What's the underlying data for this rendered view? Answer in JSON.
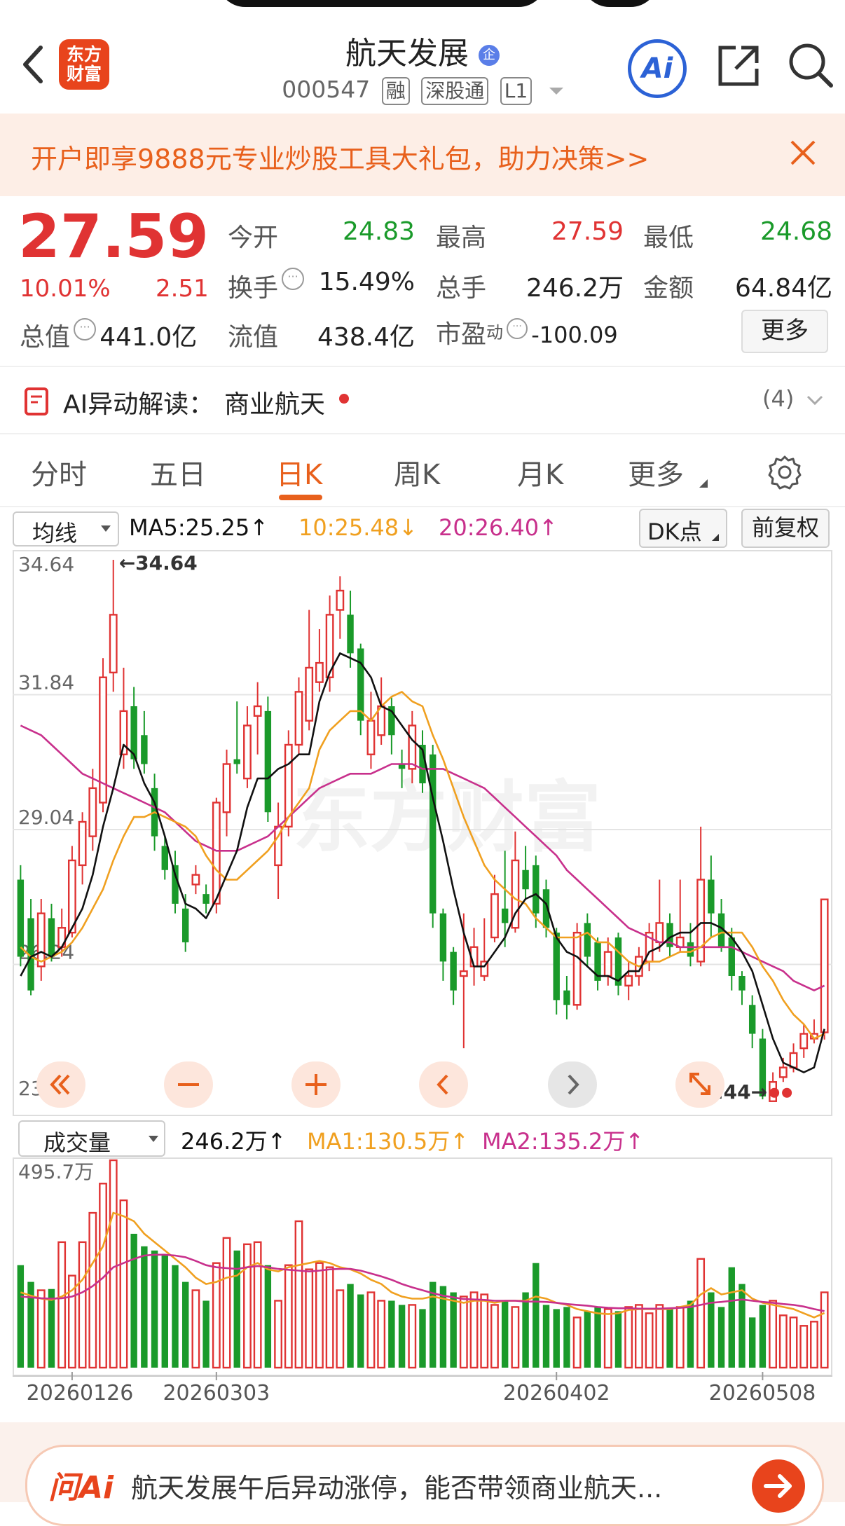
{
  "header": {
    "back_icon": "chevron-left-icon",
    "logo_text": "东方\n财富",
    "logo_line1": "东方",
    "logo_line2": "财富",
    "title": "航天发展",
    "badge": "企",
    "code": "000547",
    "tags": [
      "融",
      "深股通",
      "L1"
    ],
    "ai_label": "Ai",
    "share_icon": "share-icon",
    "search_icon": "search-icon"
  },
  "banner": {
    "text": "开户即享9888元专业炒股工具大礼包，助力决策>>",
    "close_icon": "close-icon"
  },
  "quote": {
    "price": "27.59",
    "change_pct": "10.01%",
    "change": "2.51",
    "open_label": "今开",
    "open": "24.83",
    "high_label": "最高",
    "high": "27.59",
    "low_label": "最低",
    "low": "24.68",
    "turnover_label": "换手",
    "turnover": "15.49%",
    "volume_label": "总手",
    "volume": "246.2万",
    "amount_label": "金额",
    "amount": "64.84亿",
    "mktcap_label": "总值",
    "mktcap": "441.0亿",
    "float_label": "流值",
    "float": "438.4亿",
    "pe_label": "市盈",
    "pe_sup": "动",
    "pe": "-100.09",
    "more": "更多"
  },
  "ai_reading": {
    "label": "AI异动解读：",
    "topic": "商业航天",
    "count": "(4)"
  },
  "tabs": [
    "分时",
    "五日",
    "日K",
    "周K",
    "月K",
    "更多"
  ],
  "active_tab": 2,
  "indicator_bar": {
    "select": "均线",
    "ma5": "MA5:25.25↑",
    "ma10": "10:25.48↓",
    "ma20": "20:26.40↑",
    "dk": "DK点",
    "adjust": "前复权"
  },
  "volume_bar": {
    "select": "成交量",
    "vol": "246.2万↑",
    "ma1": "MA1:130.5万↑",
    "ma2": "MA2:135.2万↑"
  },
  "colors": {
    "up": "#e03333",
    "down": "#1a9a2a",
    "ma5": "#111111",
    "ma10": "#f0a020",
    "ma20": "#c8308c",
    "accent": "#e8601c"
  },
  "chart_data": [
    {
      "type": "candlestick",
      "title": "",
      "y_ticks": [
        "34.64",
        "31.84",
        "29.04",
        "26.24",
        "23.44"
      ],
      "ylim": [
        23.44,
        34.64
      ],
      "max_label": "34.64",
      "min_label": "23.44",
      "x_ticks": [
        "20260126",
        "20260303",
        "20260402",
        "20260508"
      ],
      "candles": [
        [
          28.0,
          26.4,
          28.3,
          26.2
        ],
        [
          27.2,
          25.7,
          27.6,
          25.6
        ],
        [
          26.2,
          27.3,
          27.6,
          25.9
        ],
        [
          27.2,
          26.4,
          27.5,
          26.3
        ],
        [
          26.6,
          27.0,
          27.4,
          26.4
        ],
        [
          26.9,
          28.4,
          28.7,
          26.8
        ],
        [
          28.3,
          29.2,
          29.4,
          27.9
        ],
        [
          28.9,
          29.9,
          30.3,
          28.6
        ],
        [
          29.6,
          32.2,
          32.6,
          29.4
        ],
        [
          32.3,
          33.5,
          34.64,
          31.9
        ],
        [
          30.6,
          31.5,
          32.4,
          30.3
        ],
        [
          31.6,
          30.5,
          32.0,
          30.3
        ],
        [
          31.0,
          30.4,
          31.5,
          30.2
        ],
        [
          29.9,
          28.9,
          30.2,
          28.6
        ],
        [
          28.7,
          28.2,
          28.9,
          28.0
        ],
        [
          28.3,
          27.5,
          28.6,
          27.3
        ],
        [
          27.4,
          26.7,
          27.7,
          26.5
        ],
        [
          27.9,
          28.1,
          28.3,
          27.7
        ],
        [
          27.7,
          27.5,
          27.9,
          27.3
        ],
        [
          27.5,
          29.6,
          29.7,
          27.3
        ],
        [
          29.4,
          30.4,
          30.7,
          28.9
        ],
        [
          30.5,
          30.4,
          31.7,
          30.2
        ],
        [
          30.1,
          31.2,
          31.6,
          29.9
        ],
        [
          31.4,
          31.6,
          32.1,
          30.6
        ],
        [
          31.5,
          29.4,
          31.8,
          29.2
        ],
        [
          28.3,
          29.1,
          29.6,
          27.6
        ],
        [
          29.1,
          30.8,
          31.1,
          28.9
        ],
        [
          30.8,
          31.9,
          32.2,
          30.6
        ],
        [
          31.3,
          32.4,
          33.6,
          31.1
        ],
        [
          32.1,
          32.5,
          33.2,
          31.9
        ],
        [
          32.2,
          33.5,
          33.9,
          31.9
        ],
        [
          33.6,
          34.0,
          34.3,
          33.0
        ],
        [
          33.5,
          32.7,
          34.0,
          32.4
        ],
        [
          32.8,
          31.3,
          32.9,
          31.0
        ],
        [
          30.6,
          31.3,
          31.9,
          30.3
        ],
        [
          31.0,
          31.6,
          32.2,
          30.8
        ],
        [
          31.6,
          31.0,
          31.8,
          30.6
        ],
        [
          30.4,
          30.3,
          30.7,
          29.9
        ],
        [
          30.3,
          31.2,
          31.5,
          30.0
        ],
        [
          30.8,
          30.0,
          31.1,
          29.8
        ],
        [
          30.6,
          27.3,
          30.8,
          27.0
        ],
        [
          27.3,
          26.3,
          27.4,
          25.9
        ],
        [
          26.5,
          25.7,
          26.6,
          25.4
        ],
        [
          26.0,
          26.1,
          27.3,
          24.5
        ],
        [
          26.2,
          26.6,
          27.0,
          25.8
        ],
        [
          26.0,
          26.3,
          27.2,
          25.9
        ],
        [
          26.8,
          27.7,
          28.1,
          26.7
        ],
        [
          27.4,
          27.1,
          28.6,
          26.6
        ],
        [
          27.0,
          28.4,
          29.0,
          26.9
        ],
        [
          28.2,
          27.8,
          28.7,
          27.6
        ],
        [
          28.3,
          27.3,
          28.5,
          27.0
        ],
        [
          27.8,
          27.0,
          28.0,
          26.8
        ],
        [
          26.9,
          25.5,
          27.0,
          25.2
        ],
        [
          25.7,
          25.4,
          26.0,
          25.1
        ],
        [
          25.4,
          26.9,
          27.1,
          25.3
        ],
        [
          27.1,
          26.4,
          27.3,
          26.2
        ],
        [
          26.7,
          25.9,
          26.8,
          25.7
        ],
        [
          26.0,
          26.5,
          26.8,
          25.8
        ],
        [
          26.8,
          25.8,
          26.9,
          25.6
        ],
        [
          25.8,
          26.0,
          26.3,
          25.5
        ],
        [
          26.0,
          26.4,
          26.6,
          25.8
        ],
        [
          26.3,
          26.9,
          27.1,
          26.1
        ],
        [
          26.7,
          27.1,
          28.0,
          26.5
        ],
        [
          27.1,
          26.6,
          27.3,
          26.4
        ],
        [
          26.6,
          26.8,
          28.0,
          26.5
        ],
        [
          26.7,
          26.4,
          27.1,
          26.2
        ],
        [
          26.3,
          28.0,
          29.1,
          26.2
        ],
        [
          28.0,
          27.3,
          28.5,
          26.8
        ],
        [
          27.3,
          26.6,
          27.6,
          26.5
        ],
        [
          26.8,
          26.0,
          27.0,
          25.7
        ],
        [
          26.0,
          25.7,
          26.1,
          25.4
        ],
        [
          25.4,
          24.8,
          25.6,
          24.5
        ],
        [
          24.7,
          23.5,
          24.9,
          23.44
        ],
        [
          23.4,
          23.8,
          24.0,
          23.4
        ],
        [
          23.9,
          24.1,
          24.3,
          23.8
        ],
        [
          24.1,
          24.4,
          24.6,
          24.0
        ],
        [
          24.5,
          24.8,
          25.0,
          24.3
        ],
        [
          24.7,
          24.8,
          25.1,
          24.6
        ],
        [
          24.83,
          27.59,
          27.59,
          24.68
        ]
      ],
      "ma5": [
        26.0,
        26.4,
        26.5,
        26.4,
        26.6,
        27.0,
        27.4,
        28.1,
        29.1,
        29.9,
        30.8,
        30.6,
        30.0,
        29.6,
        28.9,
        28.1,
        27.5,
        27.4,
        27.2,
        27.6,
        28.1,
        28.6,
        29.5,
        30.1,
        30.1,
        30.3,
        30.4,
        30.6,
        30.6,
        31.7,
        32.3,
        32.7,
        32.6,
        32.5,
        32.2,
        31.6,
        31.5,
        31.2,
        30.9,
        30.7,
        29.7,
        28.8,
        27.8,
        26.9,
        26.2,
        26.2,
        26.5,
        26.8,
        27.3,
        27.6,
        27.7,
        27.5,
        26.8,
        26.5,
        26.4,
        26.2,
        26.0,
        26.0,
        25.9,
        26.1,
        26.1,
        26.5,
        26.6,
        26.8,
        26.9,
        26.9,
        27.1,
        27.1,
        27.0,
        26.8,
        26.5,
        26.1,
        25.4,
        24.7,
        24.2,
        24.1,
        24.0,
        24.1,
        24.9
      ],
      "ma10": [
        26.6,
        26.4,
        26.3,
        26.4,
        26.5,
        26.7,
        27.0,
        27.4,
        27.8,
        28.4,
        28.9,
        29.3,
        29.3,
        29.4,
        29.3,
        29.2,
        29.1,
        28.9,
        28.5,
        28.2,
        28.0,
        28.0,
        28.2,
        28.4,
        28.6,
        28.9,
        29.3,
        29.6,
        29.9,
        30.7,
        31.1,
        31.3,
        31.5,
        31.5,
        31.3,
        31.6,
        31.8,
        31.9,
        31.7,
        31.6,
        31.0,
        30.5,
        29.9,
        29.3,
        28.8,
        28.3,
        28.0,
        27.8,
        27.6,
        27.5,
        27.2,
        27.0,
        26.8,
        26.8,
        26.8,
        26.9,
        26.7,
        26.7,
        26.5,
        26.3,
        26.2,
        26.3,
        26.3,
        26.4,
        26.5,
        26.5,
        26.6,
        26.8,
        26.9,
        26.9,
        26.9,
        26.6,
        26.2,
        25.9,
        25.5,
        25.2,
        25.0,
        24.7,
        24.8
      ],
      "ma20": [
        31.2,
        31.1,
        31.0,
        30.8,
        30.6,
        30.4,
        30.2,
        30.1,
        30.0,
        29.9,
        29.8,
        29.7,
        29.6,
        29.5,
        29.4,
        29.2,
        29.0,
        28.8,
        28.7,
        28.6,
        28.6,
        28.6,
        28.7,
        28.8,
        28.9,
        29.1,
        29.3,
        29.5,
        29.7,
        29.9,
        30.0,
        30.1,
        30.2,
        30.2,
        30.2,
        30.3,
        30.4,
        30.4,
        30.4,
        30.3,
        30.3,
        30.3,
        30.2,
        30.1,
        30.0,
        29.9,
        29.7,
        29.5,
        29.3,
        29.1,
        28.9,
        28.7,
        28.5,
        28.2,
        28.0,
        27.8,
        27.6,
        27.4,
        27.2,
        27.0,
        26.9,
        26.8,
        26.7,
        26.7,
        26.6,
        26.6,
        26.6,
        26.6,
        26.6,
        26.6,
        26.5,
        26.4,
        26.3,
        26.2,
        26.1,
        25.9,
        25.8,
        25.7,
        25.8
      ]
    },
    {
      "type": "bar",
      "title": "",
      "ymax_label": "495.7万",
      "ylim": [
        0,
        495.7
      ],
      "x_ticks": [
        "20260126",
        "20260303",
        "20260402",
        "20260508"
      ],
      "values": [
        245,
        205,
        185,
        188,
        300,
        220,
        300,
        370,
        440,
        495.7,
        400,
        320,
        290,
        280,
        270,
        245,
        205,
        185,
        160,
        250,
        310,
        280,
        295,
        300,
        245,
        160,
        245,
        350,
        235,
        250,
        240,
        185,
        200,
        175,
        180,
        160,
        160,
        150,
        150,
        140,
        205,
        195,
        180,
        170,
        180,
        175,
        150,
        160,
        145,
        180,
        250,
        150,
        140,
        145,
        120,
        135,
        145,
        140,
        135,
        145,
        150,
        130,
        150,
        140,
        145,
        160,
        260,
        180,
        145,
        240,
        200,
        120,
        150,
        160,
        125,
        120,
        100,
        110,
        180
      ],
      "ma1": [
        180,
        172,
        165,
        162,
        170,
        185,
        210,
        250,
        290,
        370,
        362,
        350,
        320,
        300,
        280,
        260,
        240,
        215,
        200,
        205,
        215,
        220,
        240,
        250,
        235,
        230,
        240,
        245,
        250,
        255,
        250,
        240,
        235,
        225,
        210,
        200,
        180,
        170,
        165,
        165,
        170,
        165,
        160,
        155,
        160,
        160,
        155,
        160,
        160,
        160,
        170,
        165,
        155,
        150,
        140,
        135,
        130,
        128,
        130,
        138,
        140,
        140,
        140,
        140,
        145,
        150,
        175,
        190,
        175,
        180,
        185,
        165,
        155,
        150,
        145,
        140,
        130,
        120,
        130.5
      ],
      "ma2": [
        170,
        168,
        166,
        165,
        166,
        170,
        180,
        195,
        215,
        240,
        250,
        260,
        268,
        270,
        270,
        268,
        264,
        255,
        245,
        240,
        238,
        236,
        240,
        243,
        240,
        236,
        234,
        232,
        230,
        232,
        235,
        236,
        236,
        232,
        225,
        218,
        210,
        200,
        192,
        185,
        178,
        172,
        168,
        164,
        163,
        162,
        160,
        160,
        160,
        158,
        158,
        157,
        155,
        152,
        150,
        148,
        145,
        143,
        142,
        142,
        141,
        141,
        141,
        142,
        143,
        145,
        150,
        155,
        157,
        160,
        163,
        160,
        157,
        155,
        152,
        150,
        146,
        140,
        135.2
      ]
    }
  ],
  "chart_controls": {
    "jump_start_icon": "double-chevron-left-icon",
    "zoom_out_icon": "minus-icon",
    "zoom_in_icon": "plus-icon",
    "prev_icon": "chevron-left-icon",
    "next_icon": "chevron-right-icon",
    "expand_icon": "expand-icon"
  },
  "watermark": "东方财富",
  "bottom": {
    "brand": "问Ai",
    "text": "航天发展午后异动涨停，能否带领商业航天...",
    "go_icon": "arrow-right-icon"
  }
}
